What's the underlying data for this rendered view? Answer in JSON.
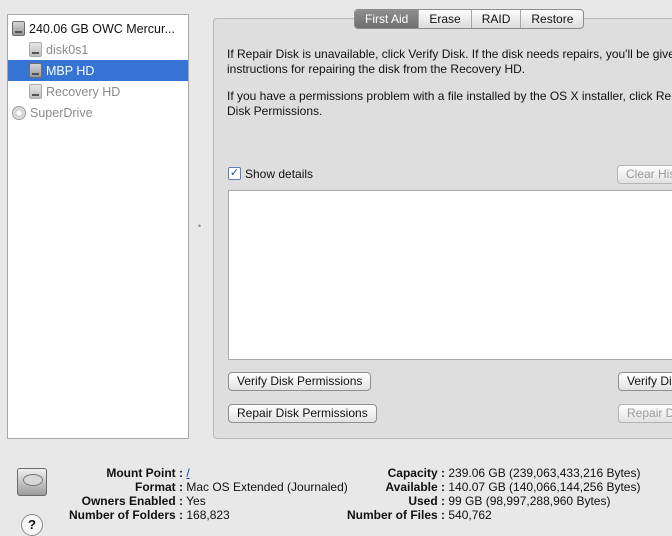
{
  "sidebar": {
    "items": [
      {
        "label": "240.06 GB OWC Mercur...",
        "icon": "hard-drive-icon"
      },
      {
        "label": "disk0s1",
        "icon": "volume-icon"
      },
      {
        "label": "MBP HD",
        "icon": "volume-icon"
      },
      {
        "label": "Recovery HD",
        "icon": "volume-icon"
      },
      {
        "label": "SuperDrive",
        "icon": "optical-drive-icon"
      }
    ]
  },
  "tabs": [
    "First Aid",
    "Erase",
    "RAID",
    "Restore"
  ],
  "first_aid": {
    "info1_line1": "If Repair Disk is unavailable, click Verify Disk. If the disk needs repairs, you'll be give",
    "info1_line2": "instructions for repairing the disk from the Recovery HD.",
    "info2_line1": "If you have a permissions problem with a file installed by the OS X installer, click Rep",
    "info2_line2": "Disk Permissions.",
    "show_details_label": "Show details",
    "show_details_checked": "✓",
    "clear_history_label": "Clear Histo",
    "verify_permissions_label": "Verify Disk Permissions",
    "repair_permissions_label": "Repair Disk Permissions",
    "verify_disk_label": "Verify Di",
    "repair_disk_label": "Repair Di"
  },
  "details": {
    "mount_point_key": "Mount Point :",
    "mount_point_val": "/",
    "format_key": "Format :",
    "format_val": "Mac OS Extended (Journaled)",
    "owners_key": "Owners Enabled :",
    "owners_val": "Yes",
    "folders_key": "Number of Folders :",
    "folders_val": "168,823",
    "capacity_key": "Capacity :",
    "capacity_val": "239.06 GB (239,063,433,216 Bytes)",
    "available_key": "Available :",
    "available_val": "140.07 GB (140,066,144,256 Bytes)",
    "used_key": "Used :",
    "used_val": "99 GB (98,997,288,960 Bytes)",
    "files_key": "Number of Files :",
    "files_val": "540,762",
    "help_glyph": "?"
  },
  "colors": {
    "selection": "#3574d4",
    "active_tab": "#7c7c7c",
    "link": "#1a3fb5"
  }
}
